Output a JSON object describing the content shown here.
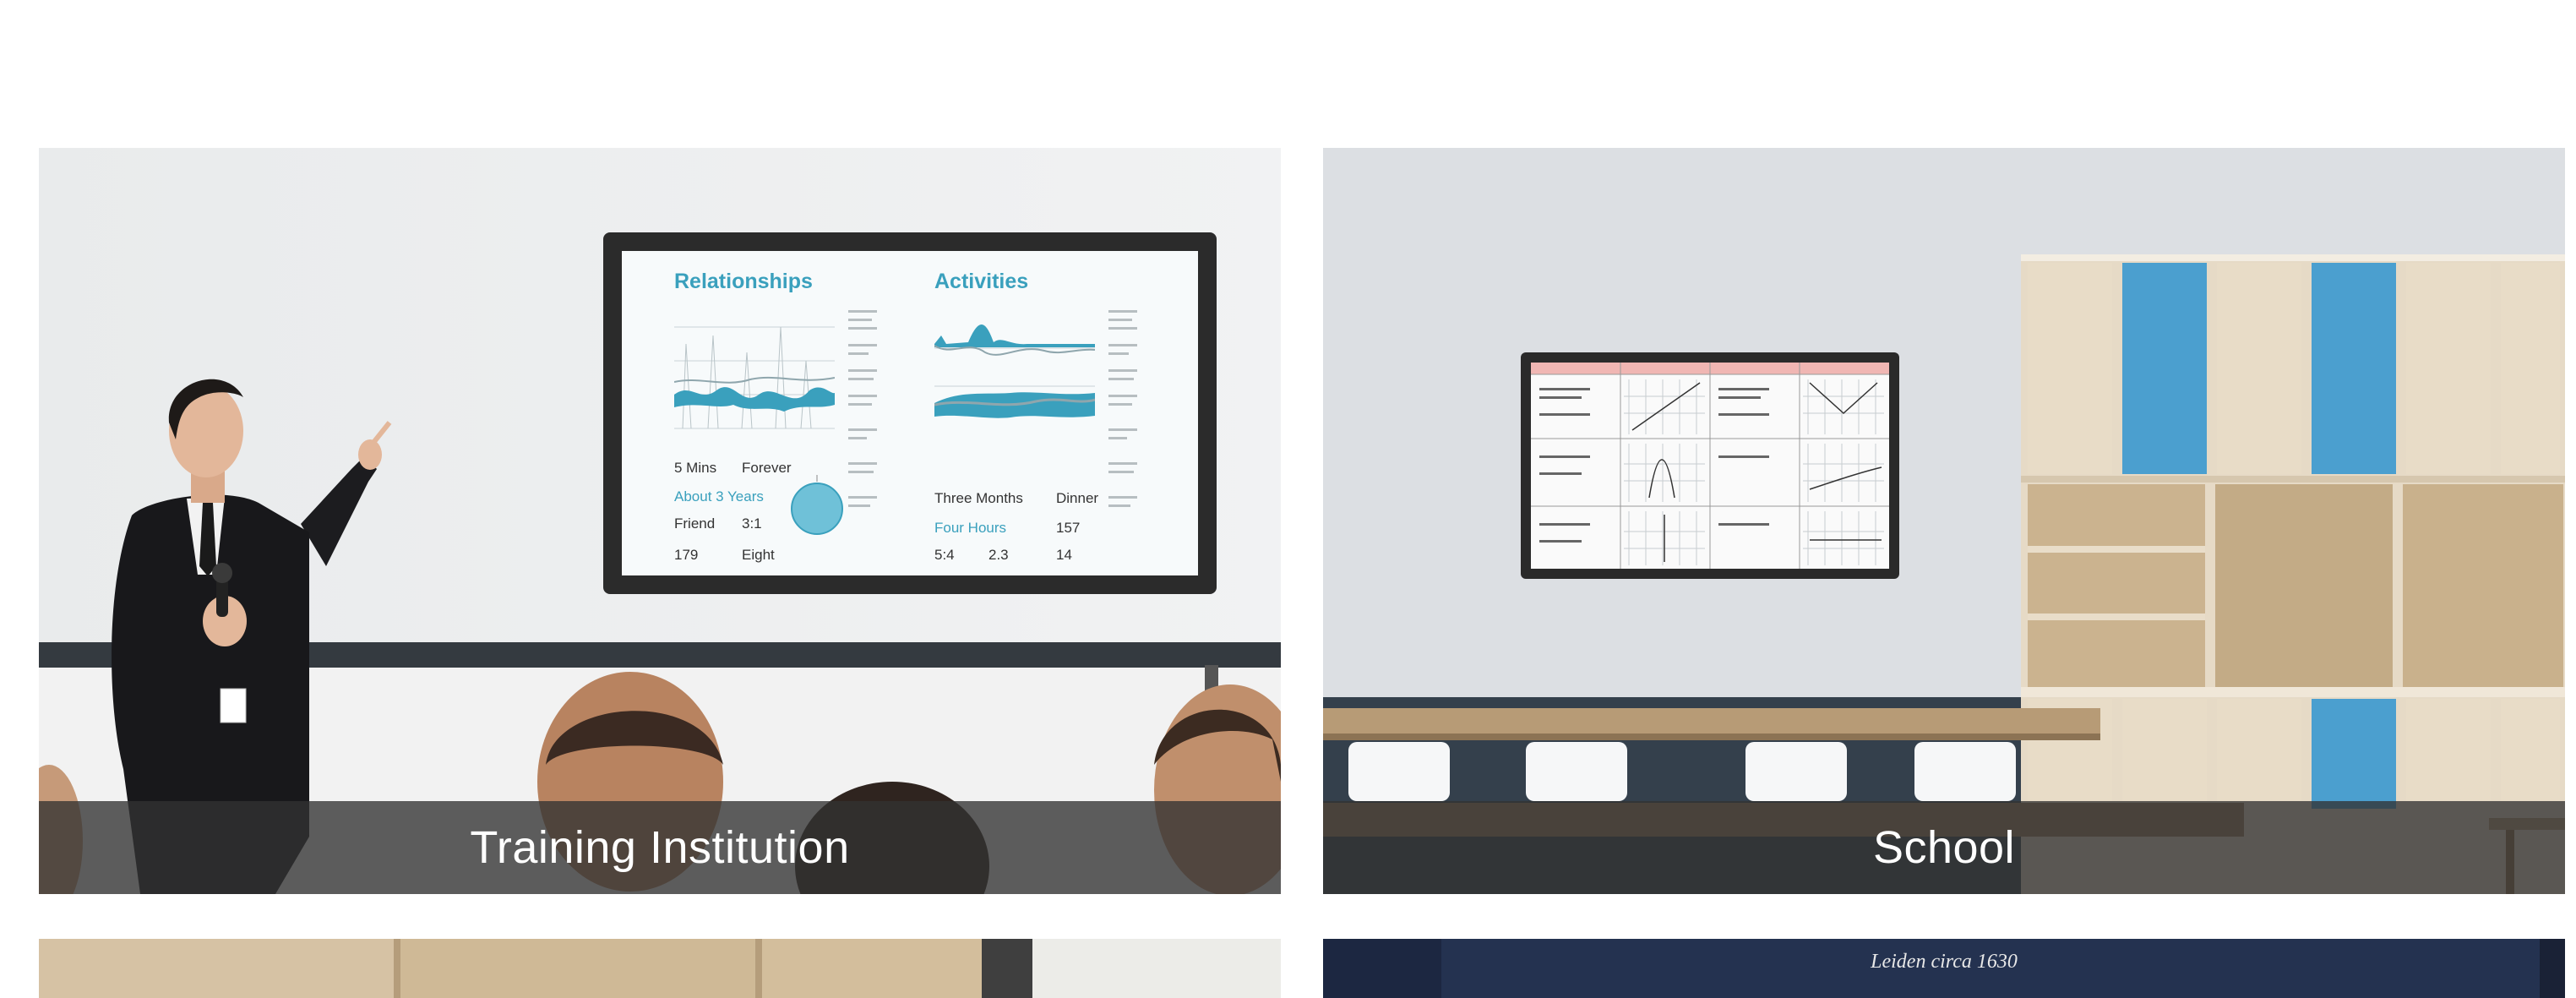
{
  "cards": [
    {
      "caption": "Training Institution"
    },
    {
      "caption": "School"
    }
  ],
  "tv1": {
    "heading_left": "Relationships",
    "heading_right": "Activities",
    "stats_left": [
      "5 Mins",
      "Forever",
      "About 3 Years",
      "Friend",
      "3:1",
      "179",
      "Eight"
    ],
    "stats_right": [
      "Three Months",
      "Dinner",
      "Four Hours",
      "157",
      "5:4",
      "2.3",
      "14"
    ]
  },
  "bottom_right_card": {
    "text": "Leiden circa 1630"
  },
  "colors": {
    "caption_bg": "#333333",
    "accent": "#3aa0bd",
    "cabinet_blue": "#4b9fcf"
  }
}
